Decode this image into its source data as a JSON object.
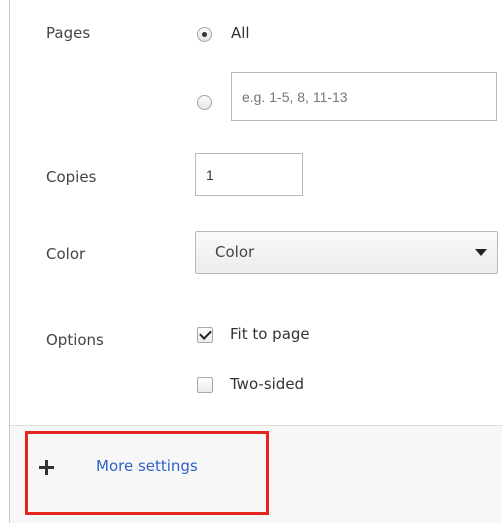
{
  "pages": {
    "label": "Pages",
    "option_all_label": "All",
    "custom_placeholder": "e.g. 1-5, 8, 11-13",
    "selected": "all"
  },
  "copies": {
    "label": "Copies",
    "value": "1"
  },
  "color": {
    "label": "Color",
    "selected": "Color"
  },
  "options": {
    "label": "Options",
    "fit_to_page": {
      "label": "Fit to page",
      "checked": true
    },
    "two_sided": {
      "label": "Two-sided",
      "checked": false
    }
  },
  "more_settings": {
    "label": "More settings"
  },
  "icons": {
    "plus": "plus-icon",
    "dropdown": "chevron-down-icon"
  },
  "colors": {
    "link": "#2f62c9",
    "highlight": "#e52620",
    "panel_bg": "#f7f7f7"
  }
}
